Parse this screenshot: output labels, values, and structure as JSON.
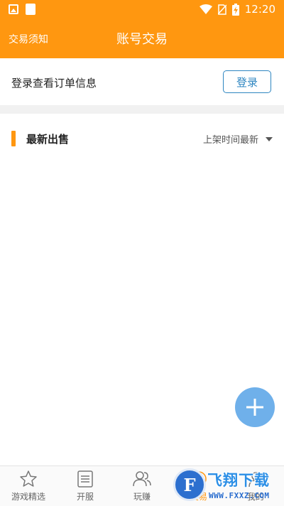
{
  "status_bar": {
    "time": "12:20"
  },
  "header": {
    "left_link": "交易须知",
    "title": "账号交易"
  },
  "login": {
    "prompt": "登录查看订单信息",
    "button_label": "登录"
  },
  "section": {
    "title": "最新出售",
    "sort_label": "上架时间最新"
  },
  "bottom_nav": {
    "items": [
      {
        "label": "游戏精选",
        "icon": "star-icon",
        "active": false
      },
      {
        "label": "开服",
        "icon": "list-icon",
        "active": false
      },
      {
        "label": "玩赚",
        "icon": "users-icon",
        "active": false
      },
      {
        "label": "交易",
        "icon": "trade-icon",
        "active": true
      },
      {
        "label": "我的",
        "icon": "profile-icon",
        "active": false
      }
    ]
  },
  "watermark": {
    "logo_text": "F",
    "title": "飞翔下载",
    "url": "WWW.FXXZ.COM"
  },
  "colors": {
    "brand": "#ff9710",
    "link_blue": "#2e86c1",
    "fab": "#6fb0ea"
  }
}
